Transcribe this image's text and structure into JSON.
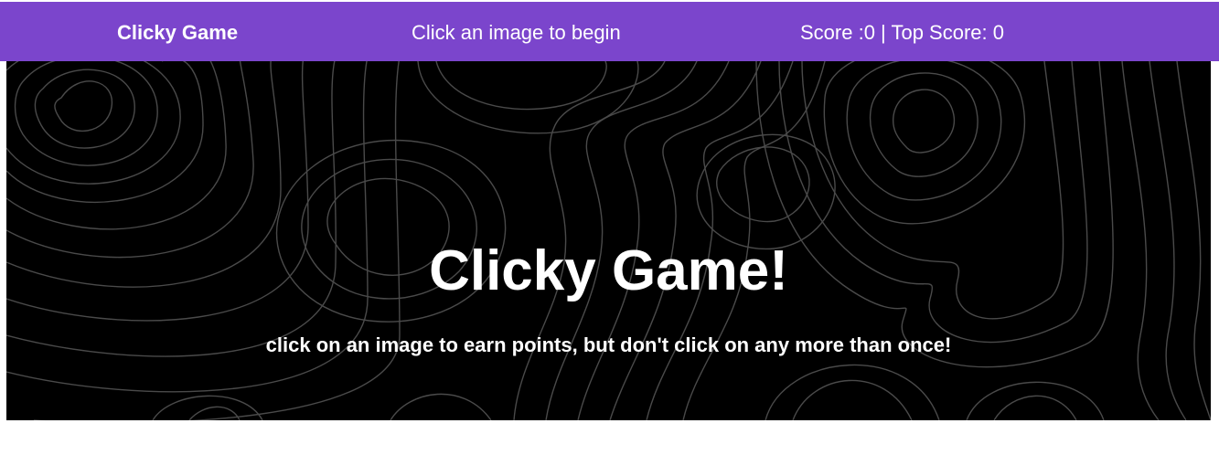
{
  "navbar": {
    "brand": "Clicky Game",
    "status_message": "Click an image to begin",
    "score_text": "Score :0 | Top Score: 0",
    "background_color": "#7b45cc"
  },
  "hero": {
    "title": "Clicky Game!",
    "subtitle": "click on an image to earn points, but don't click on any more than once!",
    "background_color": "#000000",
    "pattern": "topographic-contour-lines"
  }
}
